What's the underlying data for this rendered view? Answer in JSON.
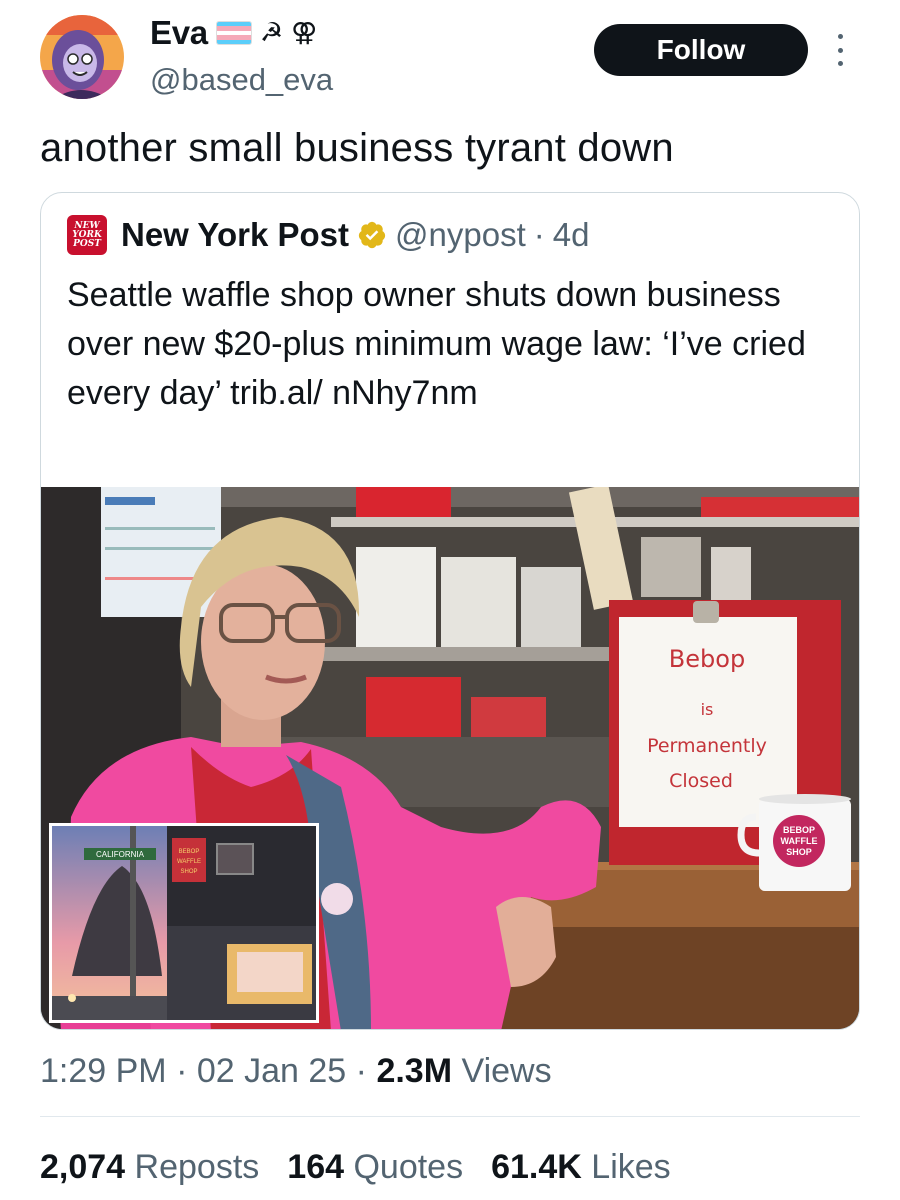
{
  "author": {
    "name": "Eva",
    "handle": "@based_eva",
    "emoji": [
      "transgender-flag",
      "hammer-and-sickle",
      "lesbian-symbol"
    ],
    "symbols": [
      "☭",
      "⚢"
    ]
  },
  "follow_label": "Follow",
  "tweet_text": "another small business tyrant down",
  "quote": {
    "logo_lines": [
      "NEW",
      "YORK",
      "POST"
    ],
    "name": "New York Post",
    "handle": "@nypost",
    "separator": "·",
    "age": "4d",
    "text": "Seattle waffle shop owner shuts down business over new $20-plus minimum wage law: ‘I’ve cried every day’ trib.al/ nNhy7nm",
    "photo": {
      "sign_lines": [
        "Bebop",
        "is",
        "Permanently",
        "Closed"
      ],
      "mug_lines": [
        "BEBOP",
        "WAFFLE",
        "SHOP"
      ],
      "street_sign": "CALIFORNIA",
      "inset_sign_lines": [
        "BEBOP",
        "WAFFLE",
        "SHOP"
      ]
    }
  },
  "meta": {
    "time": "1:29 PM",
    "sep": "·",
    "date": "02 Jan 25",
    "views_count": "2.3M",
    "views_label": "Views"
  },
  "stats": {
    "reposts_count": "2,074",
    "reposts_label": "Reposts",
    "quotes_count": "164",
    "quotes_label": "Quotes",
    "likes_count": "61.4K",
    "likes_label": "Likes"
  },
  "colors": {
    "text": "#0f1419",
    "secondary": "#536471",
    "border": "#cfd9de",
    "nypost_red": "#c8102e",
    "verified_gold": "#e2b719"
  }
}
